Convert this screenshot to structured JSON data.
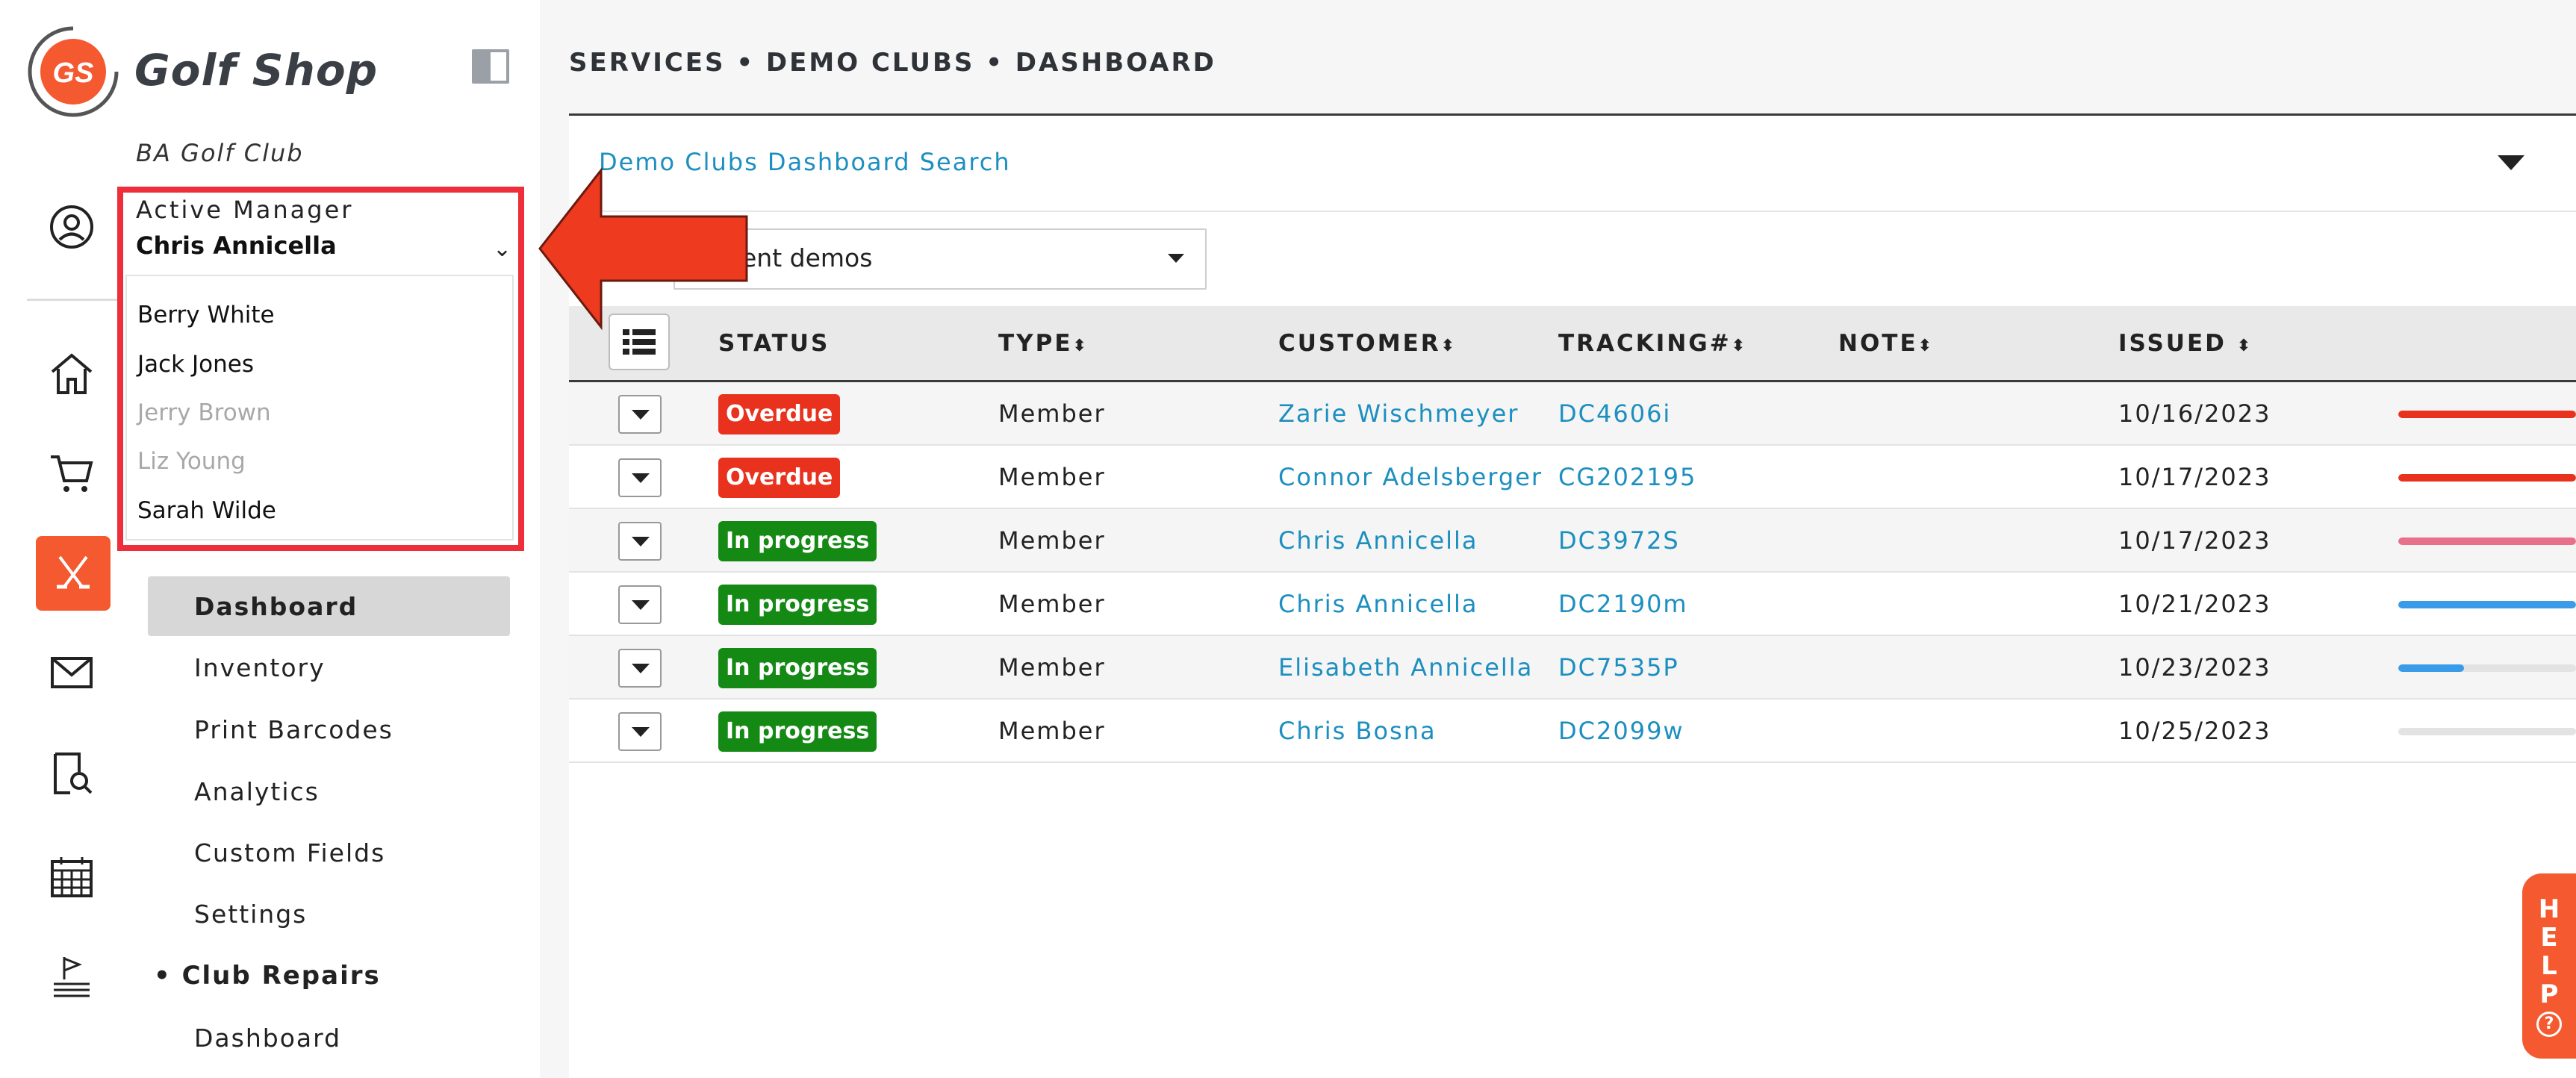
{
  "app": {
    "logo_text": "GS",
    "brand": "Golf Shop",
    "club_name": "BA Golf Club"
  },
  "manager": {
    "label": "Active Manager",
    "value": "Chris Annicella",
    "options": [
      {
        "label": "Berry White",
        "enabled": true
      },
      {
        "label": "Jack Jones",
        "enabled": true
      },
      {
        "label": "Jerry Brown",
        "enabled": false
      },
      {
        "label": "Liz Young",
        "enabled": false
      },
      {
        "label": "Sarah Wilde",
        "enabled": true
      }
    ]
  },
  "sidebar": {
    "icons": [
      "account-icon",
      "home-icon",
      "cart-icon",
      "golf-clubs-icon",
      "mail-icon",
      "search-document-icon",
      "calendar-icon",
      "golf-flag-icon"
    ],
    "demo_clubs_items": [
      "Dashboard",
      "Inventory",
      "Print Barcodes",
      "Analytics",
      "Custom Fields",
      "Settings"
    ],
    "current_item": "Dashboard",
    "club_repairs_heading": "Club Repairs",
    "club_repairs_items": [
      "Dashboard"
    ]
  },
  "main": {
    "breadcrumb": "SERVICES • DEMO CLUBS • DASHBOARD",
    "search_title": "Demo Clubs Dashboard Search",
    "filter_value": "ent demos",
    "columns": [
      "STATUS",
      "TYPE",
      "CUSTOMER",
      "TRACKING#",
      "NOTE",
      "ISSUED"
    ],
    "rows": [
      {
        "status": "Overdue",
        "type": "Member",
        "customer": "Zarie Wischmeyer",
        "tracking": "DC4606i",
        "note": "",
        "issued": "10/16/2023",
        "progress": 1.0,
        "progress_color": "#e8321e"
      },
      {
        "status": "Overdue",
        "type": "Member",
        "customer": "Connor Adelsberger",
        "tracking": "CG202195",
        "note": "",
        "issued": "10/17/2023",
        "progress": 1.0,
        "progress_color": "#e8321e"
      },
      {
        "status": "In progress",
        "type": "Member",
        "customer": "Chris Annicella",
        "tracking": "DC3972S",
        "note": "",
        "issued": "10/17/2023",
        "progress": 1.0,
        "progress_color": "#e8708a"
      },
      {
        "status": "In progress",
        "type": "Member",
        "customer": "Chris Annicella",
        "tracking": "DC2190m",
        "note": "",
        "issued": "10/21/2023",
        "progress": 1.0,
        "progress_color": "#3a9be8"
      },
      {
        "status": "In progress",
        "type": "Member",
        "customer": "Elisabeth Annicella",
        "tracking": "DC7535P",
        "note": "",
        "issued": "10/23/2023",
        "progress": 0.37,
        "progress_color": "#3a9be8"
      },
      {
        "status": "In progress",
        "type": "Member",
        "customer": "Chris Bosna",
        "tracking": "DC2099w",
        "note": "",
        "issued": "10/25/2023",
        "progress": 0.0,
        "progress_color": "#3a9be8"
      }
    ]
  },
  "colors": {
    "accent": "#f4592f",
    "overdue": "#e8321e",
    "in_progress": "#148a14",
    "link": "#1c8fc0",
    "highlight": "#ee2e3b"
  },
  "help": {
    "letters": [
      "H",
      "E",
      "L",
      "P"
    ],
    "icon": "question-circle-icon"
  }
}
